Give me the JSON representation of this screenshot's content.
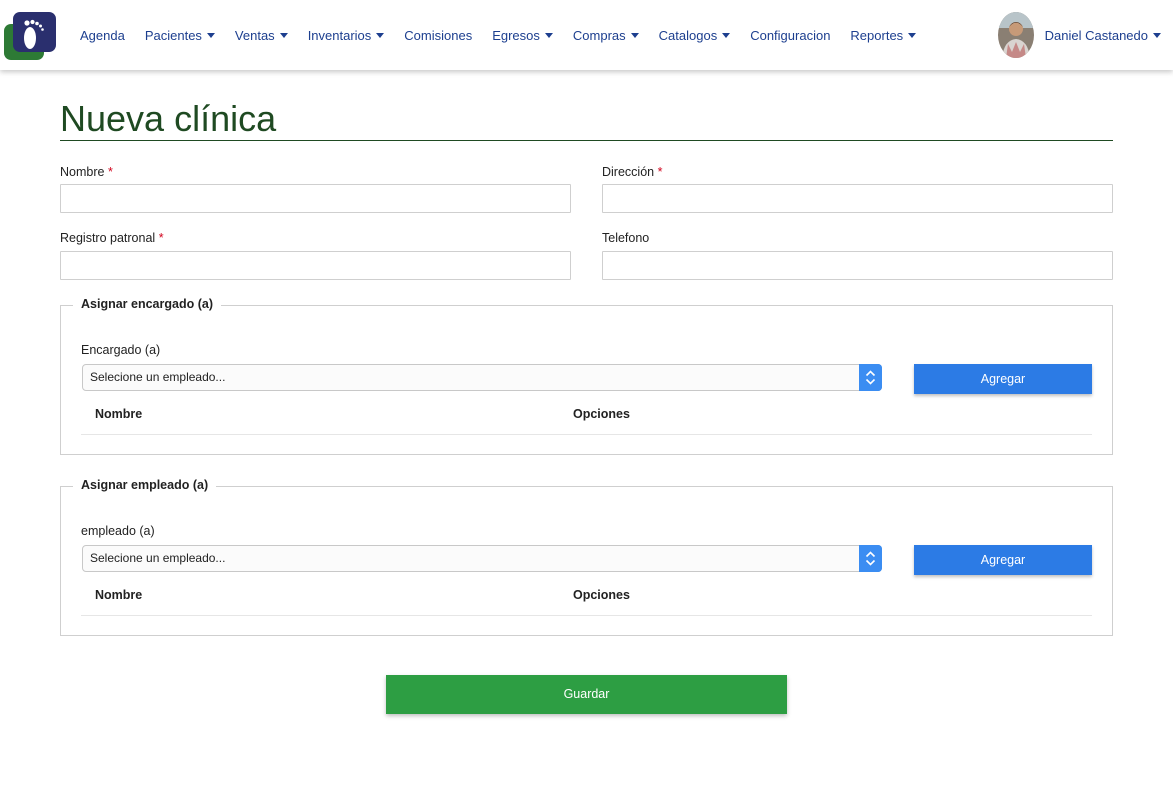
{
  "navbar": {
    "logo_icon": "footprint-logo-icon",
    "items": [
      {
        "label": "Agenda",
        "dropdown": false
      },
      {
        "label": "Pacientes",
        "dropdown": true
      },
      {
        "label": "Ventas",
        "dropdown": true
      },
      {
        "label": "Inventarios",
        "dropdown": true
      },
      {
        "label": "Comisiones",
        "dropdown": false
      },
      {
        "label": "Egresos",
        "dropdown": true
      },
      {
        "label": "Compras",
        "dropdown": true
      },
      {
        "label": "Catalogos",
        "dropdown": true
      },
      {
        "label": "Configuracion",
        "dropdown": false
      },
      {
        "label": "Reportes",
        "dropdown": true
      }
    ],
    "user_name": "Daniel Castanedo"
  },
  "page": {
    "title": "Nueva clínica"
  },
  "form": {
    "nombre_label": "Nombre",
    "direccion_label": "Dirección",
    "registro_label": "Registro patronal",
    "telefono_label": "Telefono",
    "required_mark": "*",
    "nombre_value": "",
    "direccion_value": "",
    "registro_value": "",
    "telefono_value": ""
  },
  "encargado": {
    "legend": "Asignar encargado (a)",
    "label": "Encargado (a)",
    "select_value": "Selecione un empleado...",
    "add_label": "Agregar",
    "columns": [
      "Nombre",
      "Opciones"
    ]
  },
  "empleado": {
    "legend": "Asignar empleado (a)",
    "label": "empleado (a)",
    "select_value": "Selecione un empleado...",
    "add_label": "Agregar",
    "columns": [
      "Nombre",
      "Opciones"
    ]
  },
  "actions": {
    "save_label": "Guardar"
  },
  "colors": {
    "nav_text": "#1d3f8f",
    "title": "#1f4a22",
    "primary_button": "#2c7be5",
    "save_button": "#2d9e43",
    "required": "#d0021b"
  }
}
